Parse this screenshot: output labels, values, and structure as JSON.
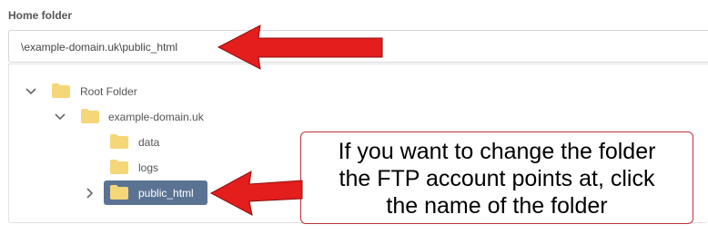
{
  "home_folder": {
    "label": "Home folder",
    "path_value": "\\example-domain.uk\\public_html"
  },
  "tree": {
    "root": {
      "label": "Root Folder",
      "expanded": true,
      "icon": "folder-icon"
    },
    "domain": {
      "label": "example-domain.uk",
      "expanded": true,
      "icon": "folder-icon"
    },
    "children": [
      {
        "label": "data",
        "icon": "folder-icon"
      },
      {
        "label": "logs",
        "icon": "folder-icon"
      },
      {
        "label": "public_html",
        "icon": "folder-icon",
        "selected": true,
        "expandable": true
      }
    ]
  },
  "callout": {
    "lines": [
      "If you want to change the folder",
      "the FTP account points at, click",
      "the name of the folder"
    ]
  },
  "colors": {
    "folder": "#f5d77a",
    "selected_bg": "#5b7393",
    "arrow": "#e41d1d",
    "callout_border": "#c0303a"
  }
}
